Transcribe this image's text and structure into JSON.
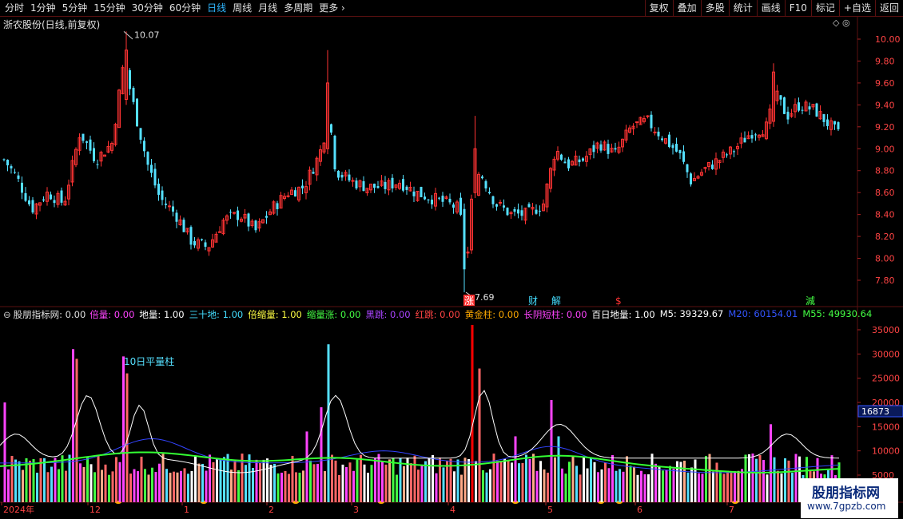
{
  "toolbar": {
    "periods": [
      "分时",
      "1分钟",
      "5分钟",
      "15分钟",
      "30分钟",
      "60分钟",
      "日线",
      "周线",
      "月线",
      "多周期",
      "更多"
    ],
    "active": "日线",
    "right_buttons": [
      "复权",
      "叠加",
      "多股",
      "统计",
      "画线",
      "F10",
      "标记",
      "+自选",
      "返回"
    ]
  },
  "main_chart": {
    "title": "浙农股份(日线,前复权)",
    "high_label": "10.07",
    "low_label": "7.69",
    "y_ticks": [
      "10.00",
      "9.80",
      "9.60",
      "9.40",
      "9.20",
      "9.00",
      "8.80",
      "8.60",
      "8.40",
      "8.20",
      "8.00",
      "7.80"
    ],
    "markers": [
      "涨",
      "财",
      "解",
      "$",
      "減"
    ]
  },
  "indicator": {
    "name": "股朋指标网",
    "value": ": 0.00",
    "items": [
      {
        "label": "倍量: 0.00",
        "color": "#ff44ff"
      },
      {
        "label": "地量: 1.00",
        "color": "#ffffff"
      },
      {
        "label": "三十地: 1.00",
        "color": "#44ddff"
      },
      {
        "label": "倍缩量: 1.00",
        "color": "#ffff44"
      },
      {
        "label": "缩量涨: 0.00",
        "color": "#44ff44"
      },
      {
        "label": "黑跳: 0.00",
        "color": "#aa44ff"
      },
      {
        "label": "红跳: 0.00",
        "color": "#ff4444"
      },
      {
        "label": "黄金柱: 0.00",
        "color": "#ffaa00"
      },
      {
        "label": "长阴短柱: 0.00",
        "color": "#ff44ff"
      },
      {
        "label": "百日地量: 1.00",
        "color": "#ffffff"
      },
      {
        "label": "M5: 39329.67",
        "color": "#ffffff"
      },
      {
        "label": "M20: 60154.01",
        "color": "#3355ff"
      },
      {
        "label": "M55: 49930.64",
        "color": "#44ff44"
      }
    ],
    "annotation": "10日平量柱",
    "y_ticks": [
      "35000",
      "30000",
      "25000",
      "20000",
      "15000",
      "10000",
      "5000"
    ],
    "current_value": "16873"
  },
  "x_axis": {
    "labels": [
      "2024年",
      "12",
      "1",
      "2",
      "3",
      "4",
      "5",
      "6",
      "7"
    ]
  },
  "watermark": {
    "line1": "股朋指标网",
    "line2": "www.7gpzb.com"
  },
  "colors": {
    "up": "#ff3333",
    "down": "#55e0ff",
    "grid": "#5a1010",
    "axis_text": "#ff4444"
  }
}
